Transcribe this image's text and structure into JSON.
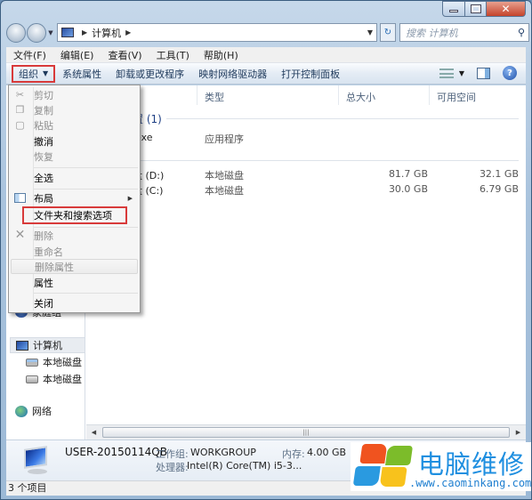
{
  "window": {
    "controls": {
      "minimize": "minimize",
      "maximize": "maximize",
      "close": "✕"
    }
  },
  "address_bar": {
    "breadcrumb": [
      "计算机"
    ],
    "search_placeholder": "搜索 计算机"
  },
  "menubar": {
    "items": [
      "文件(F)",
      "编辑(E)",
      "查看(V)",
      "工具(T)",
      "帮助(H)"
    ]
  },
  "commandbar": {
    "organize": "组织",
    "items": [
      "系统属性",
      "卸载或更改程序",
      "映射网络驱动器",
      "打开控制面板"
    ]
  },
  "columns": {
    "type": "类型",
    "total_size": "总大小",
    "free_space": "可用空间"
  },
  "content": {
    "group_other": "置 (1)",
    "app_row": {
      "name": "exe",
      "type": "应用程序"
    },
    "drives": [
      {
        "name": "盘 (D:)",
        "type": "本地磁盘",
        "total": "81.7 GB",
        "free": "32.1 GB"
      },
      {
        "name": "盘 (C:)",
        "type": "本地磁盘",
        "total": "30.0 GB",
        "free": "6.79 GB"
      }
    ]
  },
  "navpane": {
    "homegroup": "家庭组",
    "computer": "计算机",
    "drive_c": "本地磁盘 (C",
    "drive_d": "本地磁盘 (D",
    "network": "网络"
  },
  "dropdown": {
    "items": [
      {
        "label": "剪切",
        "disabled": true
      },
      {
        "label": "复制",
        "disabled": true
      },
      {
        "label": "粘贴",
        "disabled": true
      },
      {
        "label": "撤消",
        "disabled": false
      },
      {
        "label": "恢复",
        "disabled": true
      },
      {
        "label": "全选",
        "disabled": false
      },
      {
        "label": "布局",
        "disabled": false,
        "submenu": true
      },
      {
        "label": "文件夹和搜索选项",
        "disabled": false,
        "highlighted_box": true
      },
      {
        "label": "删除",
        "disabled": true
      },
      {
        "label": "重命名",
        "disabled": true
      },
      {
        "label": "删除属性",
        "disabled": true
      },
      {
        "label": "属性",
        "disabled": false
      },
      {
        "label": "关闭",
        "disabled": false
      }
    ]
  },
  "details": {
    "computer_name": "USER-20150114QB",
    "workgroup_label": "工作组:",
    "workgroup_value": "WORKGROUP",
    "memory_label": "内存:",
    "memory_value": "4.00 GB",
    "processor_label": "处理器:",
    "processor_value": "Intel(R) Core(TM) i5-3..."
  },
  "statusbar": {
    "text": "3 个项目"
  },
  "watermark": {
    "title": "电脑维修",
    "url": ".www.caominkang.com"
  },
  "colors": {
    "highlight_box": "#d83a3a",
    "watermark_blue": "#1f8fe0"
  }
}
